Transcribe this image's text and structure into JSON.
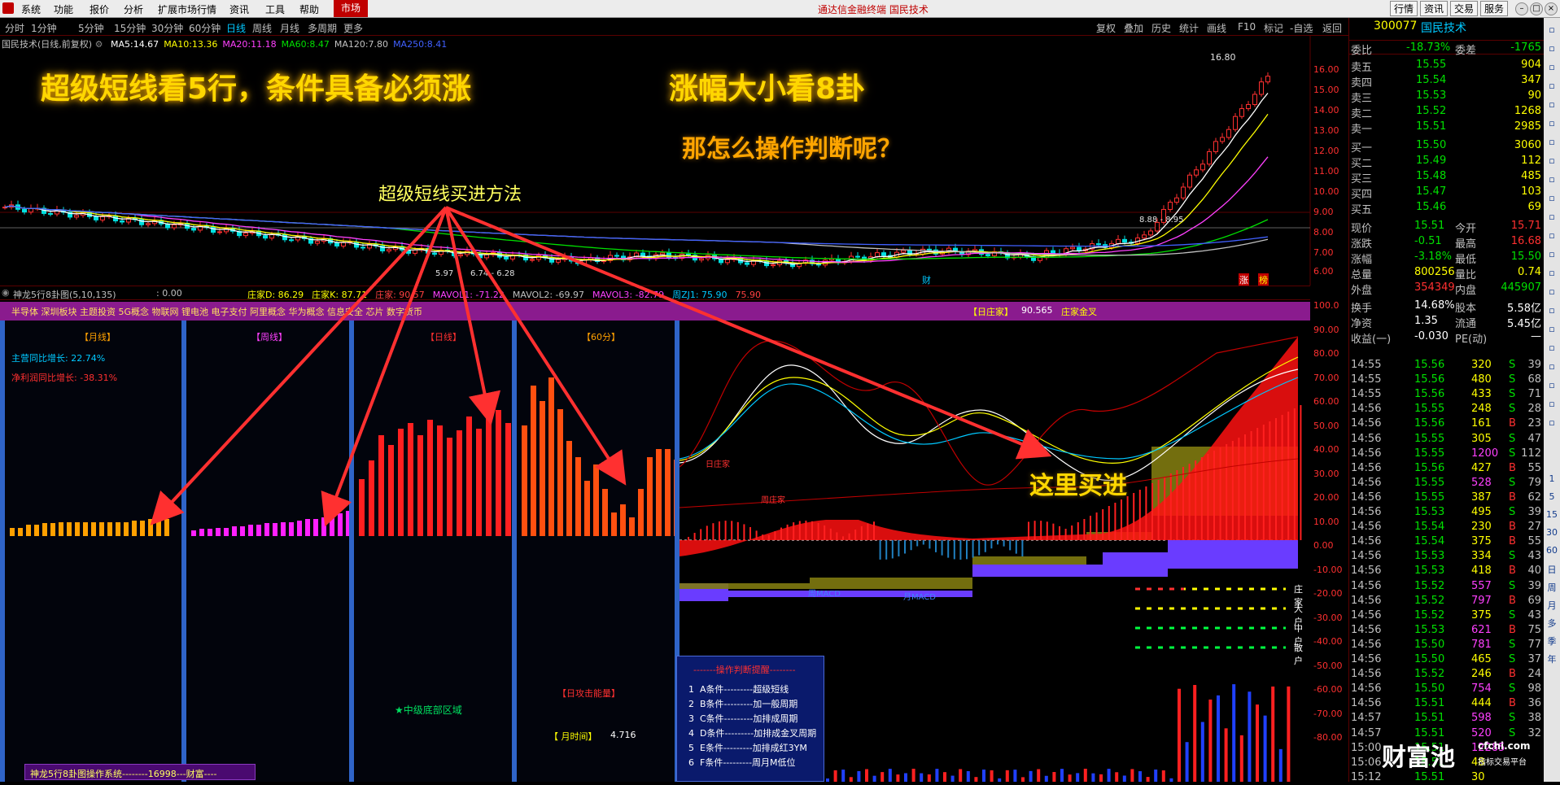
{
  "menu": {
    "items": [
      "系统",
      "功能",
      "报价",
      "分析",
      "扩展市场行情",
      "资讯",
      "工具",
      "帮助"
    ],
    "market": "市场",
    "app_title": "通达信金融终端 国民技术",
    "top_buttons": [
      "行情",
      "资讯",
      "交易",
      "服务"
    ]
  },
  "period": {
    "items": [
      "分时",
      "1分钟",
      "5分钟",
      "15分钟",
      "30分钟",
      "60分钟",
      "日线",
      "周线",
      "月线",
      "多周期",
      "更多"
    ],
    "active": "日线",
    "right": [
      "复权",
      "叠加",
      "历史",
      "统计",
      "画线",
      "F10",
      "标记",
      "-自选",
      "返回"
    ]
  },
  "chart": {
    "stock_label": "国民技术(日线,前复权)",
    "ma": [
      {
        "name": "MA5:",
        "value": "14.67",
        "color": "#ffffff"
      },
      {
        "name": "MA10:",
        "value": "13.36",
        "color": "#ffff00"
      },
      {
        "name": "MA20:",
        "value": "11.18",
        "color": "#ff40ff"
      },
      {
        "name": "MA60:",
        "value": "8.47",
        "color": "#00e000"
      },
      {
        "name": "MA120:",
        "value": "7.80",
        "color": "#c0c0c0"
      },
      {
        "name": "MA250:",
        "value": "8.41",
        "color": "#4060ff"
      }
    ],
    "price_scale": [
      "16.00",
      "15.00",
      "14.00",
      "13.00",
      "12.00",
      "11.00",
      "10.00",
      "9.00",
      "8.00",
      "7.00",
      "6.00"
    ],
    "peak_label": "16.80",
    "labels": {
      "p1": "8.88 - 8.95",
      "p2": "5.97",
      "p3": "6.74 - 6.28",
      "cai": "财",
      "zhang": "涨",
      "bang": "榜"
    }
  },
  "overlay": {
    "headline1": "超级短线看5行，条件具备必须涨",
    "headline2": "涨幅大小看8卦",
    "question": "那怎么操作判断呢？",
    "method": "超级短线买进方法",
    "buy_here": "这里买进"
  },
  "indicator": {
    "name": "神龙5行8卦图(5,10,135)",
    "value": ": 0.00",
    "items": [
      {
        "t": "庄家D: 86.29",
        "c": "#ffff00"
      },
      {
        "t": "庄家K: 87.71",
        "c": "#ffff00"
      },
      {
        "t": "庄家: 90.57",
        "c": "#ff4040"
      },
      {
        "t": "MAVOL1: -71.22",
        "c": "#ff40ff"
      },
      {
        "t": "MAVOL2: -69.97",
        "c": "#c0c0c0"
      },
      {
        "t": "MAVOL3: -82.79",
        "c": "#ff40ff"
      },
      {
        "t": "周ZJ1: 75.90",
        "c": "#00c8ff"
      },
      {
        "t": "75.90",
        "c": "#ff4040"
      }
    ],
    "concepts": "半导体 深圳板块 主题投资 5G概念 物联网 锂电池 电子支付 阿里概念 华为概念 信息安全 芯片 数字货币",
    "daily_zhuangjia": "【日庄家】",
    "daily_value": "90.565",
    "golden_cross": "庄家金叉"
  },
  "panels": {
    "monthly": "【月线】",
    "weekly": "【周线】",
    "daily": "【日线】",
    "sixty": "【60分】",
    "growth1_label": "主营同比增长:",
    "growth1": "22.74%",
    "growth2_label": "净利润同比增长:",
    "growth2": "-38.31%",
    "bottom_zone": "★中级底部区域",
    "energy": "【日攻击能量】",
    "month_time": "【 月时间】",
    "month_time_val": "4.716",
    "footer": "神龙5行8卦图操作系统--------16998---财富----"
  },
  "cond": {
    "title": "-------操作判断提醒--------",
    "items": [
      "1  A条件---------超级短线",
      "2  B条件---------加一般周期",
      "3  C条件---------加排成周期",
      "4  D条件---------加排成金叉周期",
      "5  E条件---------加排成红3YM",
      "6  F条件---------周月M低位"
    ]
  },
  "right_panel": {
    "labels": [
      "日庄家",
      "周庄家",
      "周MACD",
      "月MACD",
      "这里买进"
    ],
    "dashes": [
      "庄家",
      "大户",
      "中户",
      "散户"
    ],
    "scale": [
      "100.0",
      "90.00",
      "80.00",
      "70.00",
      "60.00",
      "50.00",
      "40.00",
      "30.00",
      "20.00",
      "10.00",
      "0.00",
      "-10.00",
      "-20.00",
      "-30.00",
      "-40.00",
      "-50.00",
      "-60.00",
      "-70.00",
      "-80.00"
    ]
  },
  "quote": {
    "code": "300077",
    "name": "国民技术",
    "webi": {
      "label": "委比",
      "value": "-18.73%",
      "label2": "委差",
      "value2": "-1765"
    },
    "sells": [
      {
        "l": "卖五",
        "p": "15.55",
        "v": "904"
      },
      {
        "l": "卖四",
        "p": "15.54",
        "v": "347"
      },
      {
        "l": "卖三",
        "p": "15.53",
        "v": "90"
      },
      {
        "l": "卖二",
        "p": "15.52",
        "v": "1268"
      },
      {
        "l": "卖一",
        "p": "15.51",
        "v": "2985"
      }
    ],
    "buys": [
      {
        "l": "买一",
        "p": "15.50",
        "v": "3060"
      },
      {
        "l": "买二",
        "p": "15.49",
        "v": "112"
      },
      {
        "l": "买三",
        "p": "15.48",
        "v": "485"
      },
      {
        "l": "买四",
        "p": "15.47",
        "v": "103"
      },
      {
        "l": "买五",
        "p": "15.46",
        "v": "69"
      }
    ],
    "stats": [
      {
        "l": "现价",
        "v": "15.51",
        "l2": "今开",
        "v2": "15.71"
      },
      {
        "l": "涨跌",
        "v": "-0.51",
        "l2": "最高",
        "v2": "16.68"
      },
      {
        "l": "涨幅",
        "v": "-3.18%",
        "l2": "最低",
        "v2": "15.50"
      },
      {
        "l": "总量",
        "v": "800256",
        "l2": "量比",
        "v2": "0.74"
      },
      {
        "l": "外盘",
        "v": "354349",
        "l2": "内盘",
        "v2": "445907"
      }
    ],
    "stats2": [
      {
        "l": "换手",
        "v": "14.68%",
        "l2": "股本",
        "v2": "5.58亿"
      },
      {
        "l": "净资",
        "v": "1.35",
        "l2": "流通",
        "v2": "5.45亿"
      },
      {
        "l": "收益(一)",
        "v": "-0.030",
        "l2": "PE(动)",
        "v2": "—"
      }
    ],
    "ticks": [
      [
        "14:55",
        "15.56",
        "320",
        "S",
        "39"
      ],
      [
        "14:55",
        "15.56",
        "480",
        "S",
        "68"
      ],
      [
        "14:55",
        "15.56",
        "433",
        "S",
        "71"
      ],
      [
        "14:56",
        "15.55",
        "248",
        "S",
        "28"
      ],
      [
        "14:56",
        "15.56",
        "161",
        "B",
        "23"
      ],
      [
        "14:56",
        "15.55",
        "305",
        "S",
        "47"
      ],
      [
        "14:56",
        "15.55",
        "1200",
        "S",
        "112"
      ],
      [
        "14:56",
        "15.56",
        "427",
        "B",
        "55"
      ],
      [
        "14:56",
        "15.55",
        "528",
        "S",
        "79"
      ],
      [
        "14:56",
        "15.55",
        "387",
        "B",
        "62"
      ],
      [
        "14:56",
        "15.53",
        "495",
        "S",
        "39"
      ],
      [
        "14:56",
        "15.54",
        "230",
        "B",
        "27"
      ],
      [
        "14:56",
        "15.54",
        "375",
        "B",
        "55"
      ],
      [
        "14:56",
        "15.53",
        "334",
        "S",
        "43"
      ],
      [
        "14:56",
        "15.53",
        "418",
        "B",
        "40"
      ],
      [
        "14:56",
        "15.52",
        "557",
        "S",
        "39"
      ],
      [
        "14:56",
        "15.52",
        "797",
        "B",
        "69"
      ],
      [
        "14:56",
        "15.52",
        "375",
        "S",
        "43"
      ],
      [
        "14:56",
        "15.53",
        "621",
        "B",
        "75"
      ],
      [
        "14:56",
        "15.50",
        "781",
        "S",
        "77"
      ],
      [
        "14:56",
        "15.50",
        "465",
        "S",
        "37"
      ],
      [
        "14:56",
        "15.52",
        "246",
        "B",
        "24"
      ],
      [
        "14:56",
        "15.50",
        "754",
        "S",
        "98"
      ],
      [
        "14:56",
        "15.51",
        "444",
        "B",
        "36"
      ],
      [
        "14:57",
        "15.51",
        "598",
        "S",
        "38"
      ],
      [
        "14:57",
        "15.51",
        "520",
        "S",
        "32"
      ],
      [
        "15:00",
        "15.51",
        "12285",
        "",
        ""
      ],
      [
        "15:06",
        "15.51",
        "48",
        "",
        ""
      ],
      [
        "15:12",
        "15.51",
        "30",
        "",
        ""
      ]
    ]
  },
  "watermark": {
    "logo": "财富池",
    "domain": "cfchi.com",
    "sub": "指标交易平台"
  },
  "side_tools": [
    "1",
    "5",
    "15",
    "30",
    "60",
    "日",
    "周",
    "月",
    "多",
    "季",
    "年"
  ]
}
